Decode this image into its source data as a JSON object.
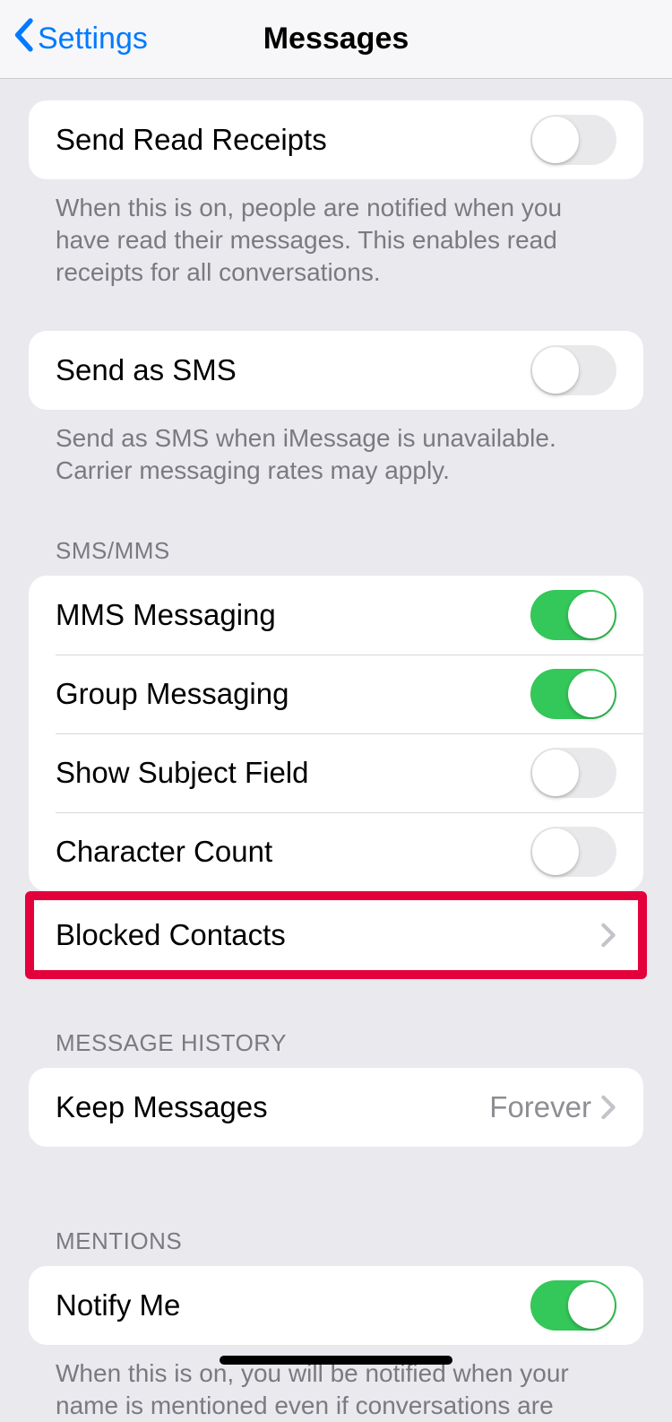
{
  "nav": {
    "back_label": "Settings",
    "title": "Messages"
  },
  "readReceipts": {
    "label": "Send Read Receipts",
    "on": false,
    "footer": "When this is on, people are notified when you have read their messages. This enables read receipts for all conversations."
  },
  "sendSms": {
    "label": "Send as SMS",
    "on": false,
    "footer": "Send as SMS when iMessage is unavailable. Carrier messaging rates may apply."
  },
  "smsSection": {
    "header": "SMS/MMS",
    "mms": {
      "label": "MMS Messaging",
      "on": true
    },
    "group": {
      "label": "Group Messaging",
      "on": true
    },
    "subject": {
      "label": "Show Subject Field",
      "on": false
    },
    "charcount": {
      "label": "Character Count",
      "on": false
    },
    "blocked": {
      "label": "Blocked Contacts"
    }
  },
  "historySection": {
    "header": "MESSAGE HISTORY",
    "keep": {
      "label": "Keep Messages",
      "value": "Forever"
    }
  },
  "mentionsSection": {
    "header": "MENTIONS",
    "notify": {
      "label": "Notify Me",
      "on": true
    },
    "footer": "When this is on, you will be notified when your name is mentioned even if conversations are"
  }
}
